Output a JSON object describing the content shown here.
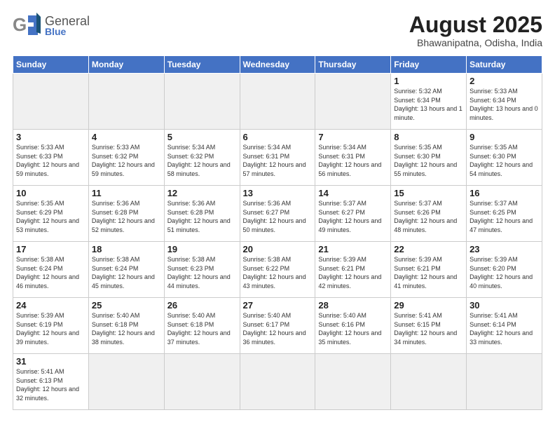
{
  "header": {
    "logo_general": "General",
    "logo_blue": "Blue",
    "title": "August 2025",
    "subtitle": "Bhawanipatna, Odisha, India"
  },
  "days_of_week": [
    "Sunday",
    "Monday",
    "Tuesday",
    "Wednesday",
    "Thursday",
    "Friday",
    "Saturday"
  ],
  "weeks": [
    [
      {
        "num": "",
        "info": "",
        "empty": true
      },
      {
        "num": "",
        "info": "",
        "empty": true
      },
      {
        "num": "",
        "info": "",
        "empty": true
      },
      {
        "num": "",
        "info": "",
        "empty": true
      },
      {
        "num": "",
        "info": "",
        "empty": true
      },
      {
        "num": "1",
        "info": "Sunrise: 5:32 AM\nSunset: 6:34 PM\nDaylight: 13 hours\nand 1 minute."
      },
      {
        "num": "2",
        "info": "Sunrise: 5:33 AM\nSunset: 6:34 PM\nDaylight: 13 hours\nand 0 minutes."
      }
    ],
    [
      {
        "num": "3",
        "info": "Sunrise: 5:33 AM\nSunset: 6:33 PM\nDaylight: 12 hours\nand 59 minutes."
      },
      {
        "num": "4",
        "info": "Sunrise: 5:33 AM\nSunset: 6:32 PM\nDaylight: 12 hours\nand 59 minutes."
      },
      {
        "num": "5",
        "info": "Sunrise: 5:34 AM\nSunset: 6:32 PM\nDaylight: 12 hours\nand 58 minutes."
      },
      {
        "num": "6",
        "info": "Sunrise: 5:34 AM\nSunset: 6:31 PM\nDaylight: 12 hours\nand 57 minutes."
      },
      {
        "num": "7",
        "info": "Sunrise: 5:34 AM\nSunset: 6:31 PM\nDaylight: 12 hours\nand 56 minutes."
      },
      {
        "num": "8",
        "info": "Sunrise: 5:35 AM\nSunset: 6:30 PM\nDaylight: 12 hours\nand 55 minutes."
      },
      {
        "num": "9",
        "info": "Sunrise: 5:35 AM\nSunset: 6:30 PM\nDaylight: 12 hours\nand 54 minutes."
      }
    ],
    [
      {
        "num": "10",
        "info": "Sunrise: 5:35 AM\nSunset: 6:29 PM\nDaylight: 12 hours\nand 53 minutes."
      },
      {
        "num": "11",
        "info": "Sunrise: 5:36 AM\nSunset: 6:28 PM\nDaylight: 12 hours\nand 52 minutes."
      },
      {
        "num": "12",
        "info": "Sunrise: 5:36 AM\nSunset: 6:28 PM\nDaylight: 12 hours\nand 51 minutes."
      },
      {
        "num": "13",
        "info": "Sunrise: 5:36 AM\nSunset: 6:27 PM\nDaylight: 12 hours\nand 50 minutes."
      },
      {
        "num": "14",
        "info": "Sunrise: 5:37 AM\nSunset: 6:27 PM\nDaylight: 12 hours\nand 49 minutes."
      },
      {
        "num": "15",
        "info": "Sunrise: 5:37 AM\nSunset: 6:26 PM\nDaylight: 12 hours\nand 48 minutes."
      },
      {
        "num": "16",
        "info": "Sunrise: 5:37 AM\nSunset: 6:25 PM\nDaylight: 12 hours\nand 47 minutes."
      }
    ],
    [
      {
        "num": "17",
        "info": "Sunrise: 5:38 AM\nSunset: 6:24 PM\nDaylight: 12 hours\nand 46 minutes."
      },
      {
        "num": "18",
        "info": "Sunrise: 5:38 AM\nSunset: 6:24 PM\nDaylight: 12 hours\nand 45 minutes."
      },
      {
        "num": "19",
        "info": "Sunrise: 5:38 AM\nSunset: 6:23 PM\nDaylight: 12 hours\nand 44 minutes."
      },
      {
        "num": "20",
        "info": "Sunrise: 5:38 AM\nSunset: 6:22 PM\nDaylight: 12 hours\nand 43 minutes."
      },
      {
        "num": "21",
        "info": "Sunrise: 5:39 AM\nSunset: 6:21 PM\nDaylight: 12 hours\nand 42 minutes."
      },
      {
        "num": "22",
        "info": "Sunrise: 5:39 AM\nSunset: 6:21 PM\nDaylight: 12 hours\nand 41 minutes."
      },
      {
        "num": "23",
        "info": "Sunrise: 5:39 AM\nSunset: 6:20 PM\nDaylight: 12 hours\nand 40 minutes."
      }
    ],
    [
      {
        "num": "24",
        "info": "Sunrise: 5:39 AM\nSunset: 6:19 PM\nDaylight: 12 hours\nand 39 minutes."
      },
      {
        "num": "25",
        "info": "Sunrise: 5:40 AM\nSunset: 6:18 PM\nDaylight: 12 hours\nand 38 minutes."
      },
      {
        "num": "26",
        "info": "Sunrise: 5:40 AM\nSunset: 6:18 PM\nDaylight: 12 hours\nand 37 minutes."
      },
      {
        "num": "27",
        "info": "Sunrise: 5:40 AM\nSunset: 6:17 PM\nDaylight: 12 hours\nand 36 minutes."
      },
      {
        "num": "28",
        "info": "Sunrise: 5:40 AM\nSunset: 6:16 PM\nDaylight: 12 hours\nand 35 minutes."
      },
      {
        "num": "29",
        "info": "Sunrise: 5:41 AM\nSunset: 6:15 PM\nDaylight: 12 hours\nand 34 minutes."
      },
      {
        "num": "30",
        "info": "Sunrise: 5:41 AM\nSunset: 6:14 PM\nDaylight: 12 hours\nand 33 minutes."
      }
    ],
    [
      {
        "num": "31",
        "info": "Sunrise: 5:41 AM\nSunset: 6:13 PM\nDaylight: 12 hours\nand 32 minutes."
      },
      {
        "num": "",
        "info": "",
        "empty": true
      },
      {
        "num": "",
        "info": "",
        "empty": true
      },
      {
        "num": "",
        "info": "",
        "empty": true
      },
      {
        "num": "",
        "info": "",
        "empty": true
      },
      {
        "num": "",
        "info": "",
        "empty": true
      },
      {
        "num": "",
        "info": "",
        "empty": true
      }
    ]
  ]
}
